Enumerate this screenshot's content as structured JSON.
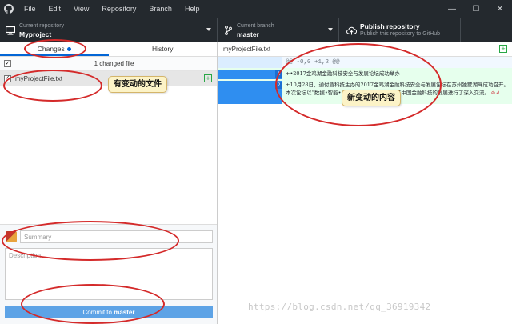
{
  "menubar": {
    "items": [
      "File",
      "Edit",
      "View",
      "Repository",
      "Branch",
      "Help"
    ],
    "controls": [
      "—",
      "☐",
      "✕"
    ]
  },
  "toolbar": {
    "repo": {
      "caption": "Current repository",
      "value": "Myproject"
    },
    "branch": {
      "caption": "Current branch",
      "value": "master"
    },
    "publish": {
      "title": "Publish repository",
      "subtitle": "Publish this repository to GitHub"
    }
  },
  "sidebar": {
    "tabs": [
      {
        "label": "Changes",
        "active": true
      },
      {
        "label": "History",
        "active": false
      }
    ],
    "changed_count_text": "1 changed file",
    "files": [
      {
        "name": "myProjectFile.txt",
        "status": "+"
      }
    ],
    "summary_placeholder": "Summary",
    "description_placeholder": "Description",
    "commit_prefix": "Commit to ",
    "commit_branch": "master"
  },
  "diff": {
    "file_name": "myProjectFile.txt",
    "hunk_header": "@@ -0,0 +1,2 @@",
    "lines": [
      {
        "number": "1",
        "text": "+•2017金鸡湖金融科技安全与发展论坛成功举办"
      },
      {
        "number": "2",
        "text": "+10月28日，通付盾科技主办的2017金鸡湖金融科技安全与发展论坛在苏州独墅湖畔成功召开。本次论坛以“数据•智能•安全”为主题，共同探讨了中国金融科技的发展进行了深入交流。",
        "end_mark": "⊘↵"
      }
    ]
  },
  "annotations": {
    "callout_files": "有变动的文件",
    "callout_content": "新变动的内容"
  },
  "watermark": "https://blog.csdn.net/qq_36919342"
}
